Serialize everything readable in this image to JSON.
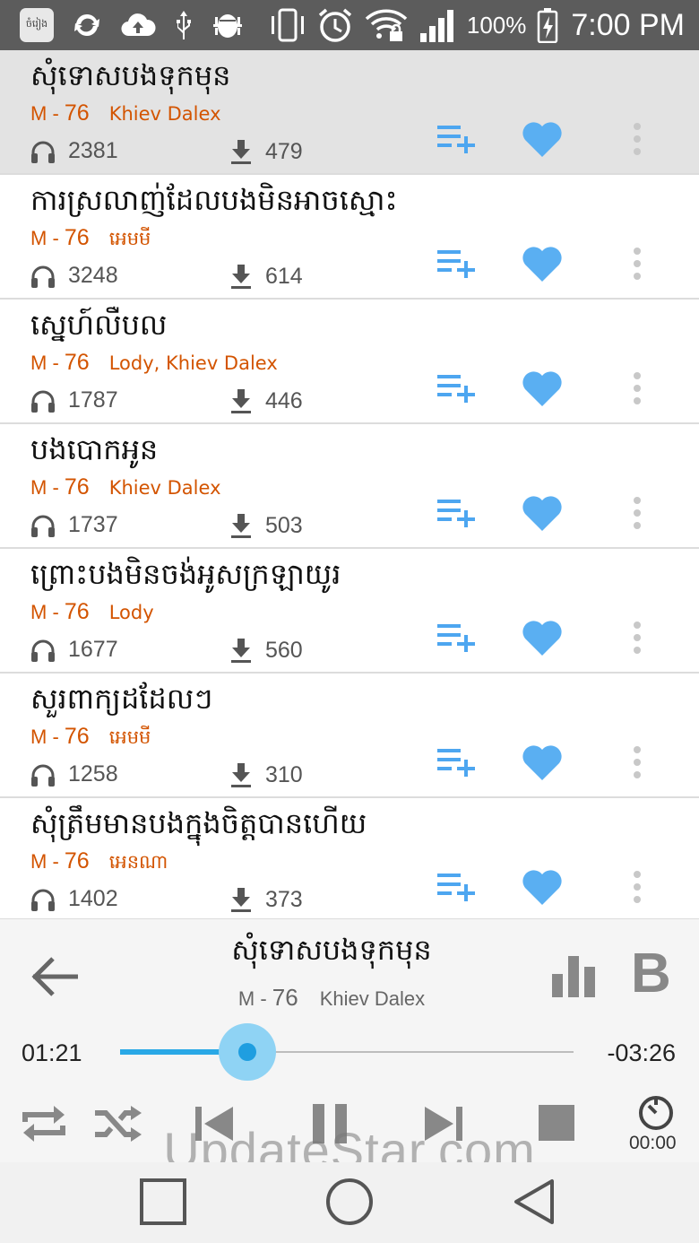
{
  "status_bar": {
    "app_icon_label": "ចំរៀង",
    "battery_percent": "100%",
    "time": "7:00 PM",
    "icons": [
      "app-icon",
      "sync-icon",
      "cloud-upload-icon",
      "usb-icon",
      "android-debug-icon",
      "vibrate-icon",
      "alarm-icon",
      "wifi-lock-icon",
      "signal-icon",
      "battery-charging-icon"
    ]
  },
  "songs": [
    {
      "title": "សុំទោសបងទុកមុន",
      "code_prefix": "M - ",
      "code_num": "76",
      "artist": "Khiev Dalex",
      "plays": "2381",
      "downloads": "479",
      "active": true
    },
    {
      "title": "ការស្រលាញ់ដែលបងមិនអាចស្មោះ",
      "code_prefix": "M - ",
      "code_num": "76",
      "artist": "អេមមី",
      "plays": "3248",
      "downloads": "614",
      "active": false
    },
    {
      "title": "ស្នេហ៍លឺបល",
      "code_prefix": "M - ",
      "code_num": "76",
      "artist": "Lody, Khiev Dalex",
      "plays": "1787",
      "downloads": "446",
      "active": false
    },
    {
      "title": "បងបោកអូន",
      "code_prefix": "M - ",
      "code_num": "76",
      "artist": "Khiev Dalex",
      "plays": "1737",
      "downloads": "503",
      "active": false
    },
    {
      "title": "ព្រោះបងមិនចង់អូសក្រឡាយូរ",
      "code_prefix": "M - ",
      "code_num": "76",
      "artist": "Lody",
      "plays": "1677",
      "downloads": "560",
      "active": false
    },
    {
      "title": "សួរពាក្យដដែលៗ",
      "code_prefix": "M - ",
      "code_num": "76",
      "artist": "អេមមី",
      "plays": "1258",
      "downloads": "310",
      "active": false
    },
    {
      "title": "សុំត្រឹមមានបងក្នុងចិត្តបានហើយ",
      "code_prefix": "M - ",
      "code_num": "76",
      "artist": "អេនណា",
      "plays": "1402",
      "downloads": "373",
      "active": false
    }
  ],
  "player": {
    "title": "សុំទោសបងទុកមុន",
    "code_prefix": "M - ",
    "code_num": "76",
    "artist": "Khiev Dalex",
    "elapsed": "01:21",
    "remaining": "-03:26",
    "progress_fraction": 0.28,
    "b_label": "B",
    "sleep_timer": "00:00"
  },
  "watermark": "UpdateStar.com",
  "colors": {
    "accent": "#4da6f0",
    "meta": "#d35400",
    "seek": "#29a8e6",
    "status_bar": "#5c5c5c"
  }
}
